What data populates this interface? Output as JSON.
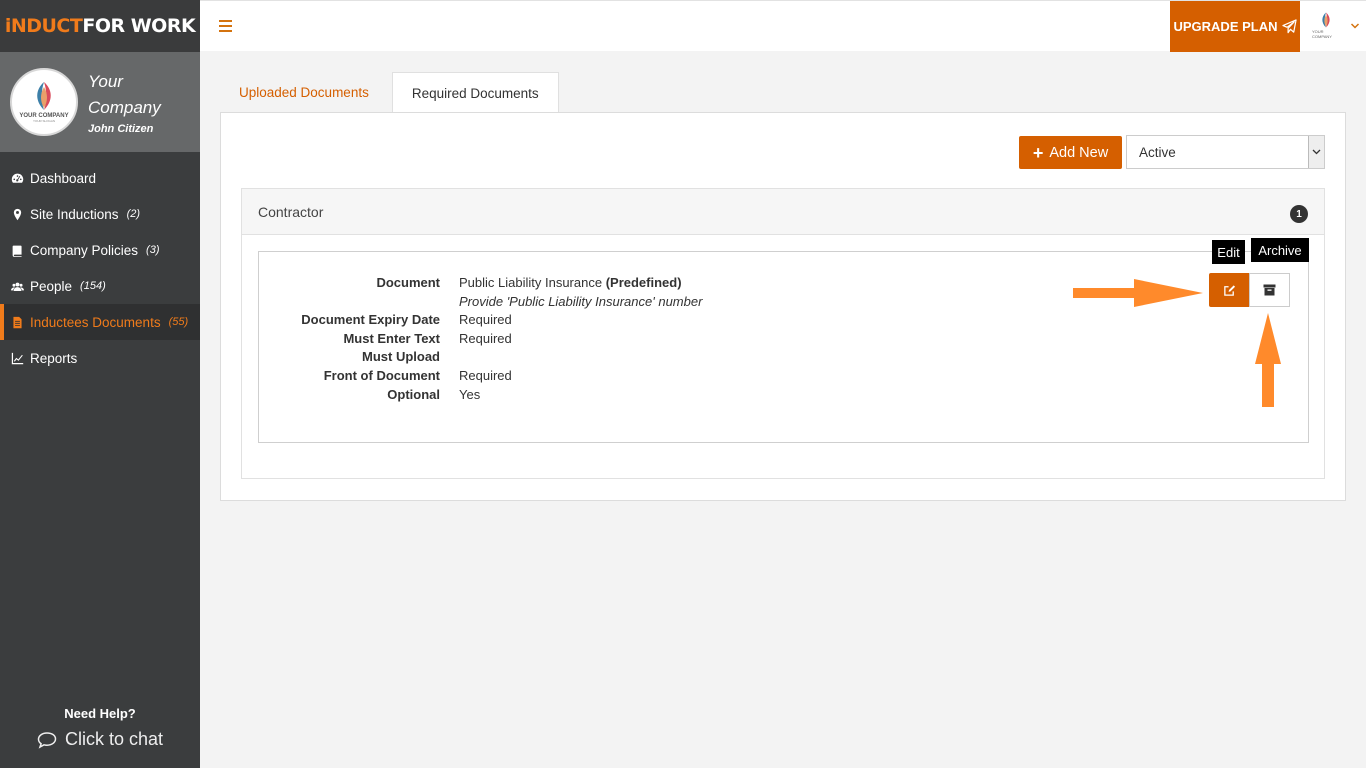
{
  "brand": {
    "part1": "iNDUCT",
    "part2": "FOR WORK"
  },
  "profile": {
    "company_name": "Your Company",
    "user_name": "John Citizen",
    "logo_text": "YOUR COMPANY",
    "logo_sub": "YOUR SLOGAN"
  },
  "nav": {
    "items": [
      {
        "label": "Dashboard",
        "count": "",
        "icon": "dashboard-icon"
      },
      {
        "label": "Site Inductions",
        "count": "(2)",
        "icon": "map-marker-icon"
      },
      {
        "label": "Company Policies",
        "count": "(3)",
        "icon": "book-icon"
      },
      {
        "label": "People",
        "count": "(154)",
        "icon": "users-icon"
      },
      {
        "label": "Inductees Documents",
        "count": "(55)",
        "icon": "document-icon"
      },
      {
        "label": "Reports",
        "count": "",
        "icon": "chart-line-icon"
      }
    ]
  },
  "help": {
    "title": "Need Help?",
    "chat": "Click to chat"
  },
  "topbar": {
    "upgrade_label": "UPGRADE PLAN",
    "avatar_text": "YOUR COMPANY"
  },
  "tabs": [
    {
      "label": "Uploaded Documents"
    },
    {
      "label": "Required Documents"
    }
  ],
  "toolbar": {
    "add_new_label": "Add New",
    "status_filter": "Active"
  },
  "group": {
    "title": "Contractor",
    "count": "1",
    "document": {
      "rows": [
        {
          "label": "Document",
          "value": "Public Liability Insurance",
          "value_bold": "(Predefined)"
        },
        {
          "label": "",
          "value": "Provide 'Public Liability Insurance' number"
        },
        {
          "label": "Document Expiry Date",
          "value": "Required"
        },
        {
          "label": "Must Enter Text",
          "value": "Required"
        },
        {
          "label": "Must Upload",
          "value": ""
        },
        {
          "label": "Front of Document",
          "value": "Required"
        },
        {
          "label": "Optional",
          "value": "Yes"
        }
      ],
      "edit_tooltip": "Edit",
      "archive_tooltip": "Archive"
    }
  },
  "colors": {
    "accent": "#d55f00",
    "sidebar": "#3b3d3e",
    "annotation": "#ff8a2b"
  }
}
